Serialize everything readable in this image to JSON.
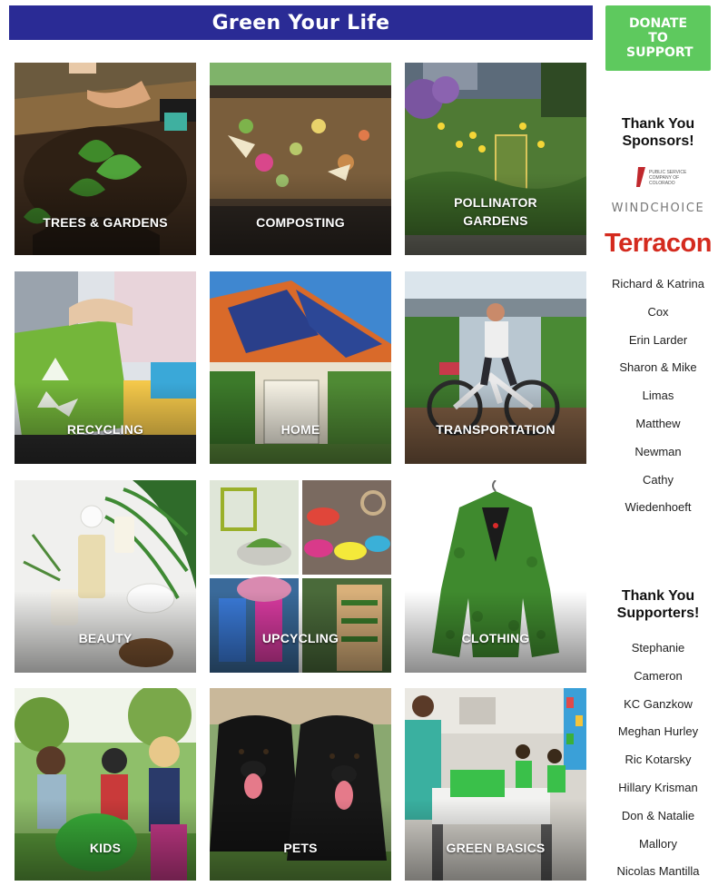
{
  "banner": {
    "title": "Green Your Life"
  },
  "donate": {
    "label": "DONATE TO SUPPORT"
  },
  "tiles": [
    {
      "label": "TREES & GARDENS"
    },
    {
      "label": "COMPOSTING"
    },
    {
      "label": "POLLINATOR GARDENS"
    },
    {
      "label": "RECYCLING"
    },
    {
      "label": "HOME"
    },
    {
      "label": "TRANSPORTATION"
    },
    {
      "label": "BEAUTY"
    },
    {
      "label": "UPCYCLING"
    },
    {
      "label": "CLOTHING"
    },
    {
      "label": "KIDS"
    },
    {
      "label": "PETS"
    },
    {
      "label": "GREEN BASICS"
    }
  ],
  "sponsors": {
    "heading": "Thank You Sponsors!",
    "logos": {
      "public_service": "PUBLIC SERVICE COMPANY OF COLORADO",
      "windchoice": "WINDCHOICE",
      "terracon": "Terracon"
    },
    "names": [
      "Richard & Katrina",
      "Cox",
      "Erin Larder",
      "Sharon & Mike",
      "Limas",
      "Matthew",
      "Newman",
      "Cathy",
      "Wiedenhoeft"
    ]
  },
  "supporters": {
    "heading": "Thank You Supporters!",
    "names": [
      "Stephanie",
      "Cameron",
      "KC Ganzkow",
      "Meghan Hurley",
      "Ric Kotarsky",
      "Hillary Krisman",
      "Don & Natalie",
      "Mallory",
      "Nicolas Mantilla"
    ]
  },
  "colors": {
    "banner": "#2a2b95",
    "donate": "#5ec95e",
    "terracon": "#d42a1e"
  }
}
